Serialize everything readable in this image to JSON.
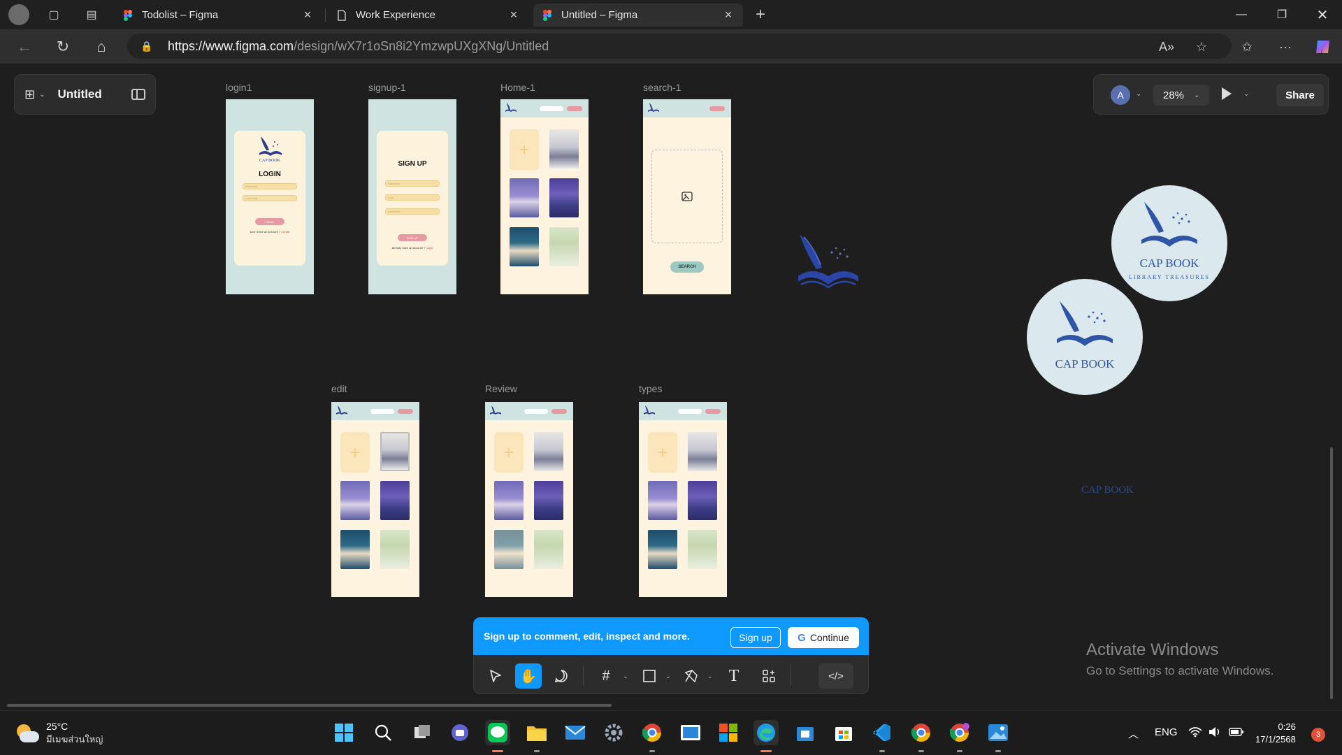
{
  "browser": {
    "tabs": [
      {
        "title": "Todolist – Figma",
        "active": false
      },
      {
        "title": "Work Experience",
        "active": false
      },
      {
        "title": "Untitled – Figma",
        "active": true
      }
    ],
    "url_host": "https://www.figma.com",
    "url_path": "/design/wX7r1oSn8i2YmzwpUXgXNg/Untitled"
  },
  "figma": {
    "file_name": "Untitled",
    "avatar_initial": "A",
    "zoom": "28%",
    "share_label": "Share",
    "frames": [
      {
        "label": "login1"
      },
      {
        "label": "signup-1"
      },
      {
        "label": "Home-1"
      },
      {
        "label": "search-1"
      },
      {
        "label": "edit"
      },
      {
        "label": "Review"
      },
      {
        "label": "types"
      }
    ],
    "login": {
      "logo_text": "CAP BOOK",
      "title": "LOGIN",
      "btn": "LOGIN",
      "field1": "PASSWORD",
      "field2": "USERNAME",
      "foot": "Don't have an Account ?",
      "foot_link": "Create"
    },
    "signup": {
      "title": "SIGN UP",
      "field1": "USERNAME",
      "field2": "Email",
      "field3": "PASSWORD",
      "btn": "SIGN UP",
      "foot": "Already have an Account ?",
      "foot_link": "Login"
    },
    "search": {
      "btn": "SEARCH"
    },
    "logo_circle_1": {
      "line1": "CAP BOOK",
      "line2": "LIBRARY TREASURES"
    },
    "logo_circle_2": {
      "line1": "CAP BOOK"
    },
    "loose_text": "CAP BOOK",
    "banner": {
      "message": "Sign up to comment, edit, inspect and more.",
      "signup": "Sign up",
      "continue": "Continue"
    }
  },
  "windows": {
    "activate_title": "Activate Windows",
    "activate_sub": "Go to Settings to activate Windows.",
    "weather_temp": "25°C",
    "weather_cond": "มีเมฆส่วนใหญ่",
    "lang": "ENG",
    "time": "0:26",
    "date": "17/1/2568",
    "notifications": "3"
  },
  "colors": {
    "accent": "#0d99ff",
    "mint": "#cfe3e0",
    "cream": "#fdf3de",
    "logo_blue": "#2f56a6"
  }
}
